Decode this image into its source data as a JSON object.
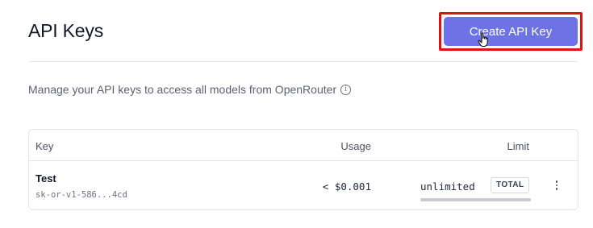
{
  "header": {
    "title": "API Keys",
    "create_button_label": "Create API Key"
  },
  "description": {
    "text": "Manage your API keys to access all models from OpenRouter",
    "info_icon": "info-icon"
  },
  "table": {
    "columns": [
      "Key",
      "Usage",
      "Limit"
    ],
    "rows": [
      {
        "name": "Test",
        "masked_key": "sk-or-v1-586...4cd",
        "usage": "< $0.001",
        "limit": "unlimited",
        "limit_badge": "TOTAL",
        "limit_used_fraction": 0
      }
    ]
  },
  "colors": {
    "accent": "#6d73e6",
    "highlight": "#e11111"
  }
}
